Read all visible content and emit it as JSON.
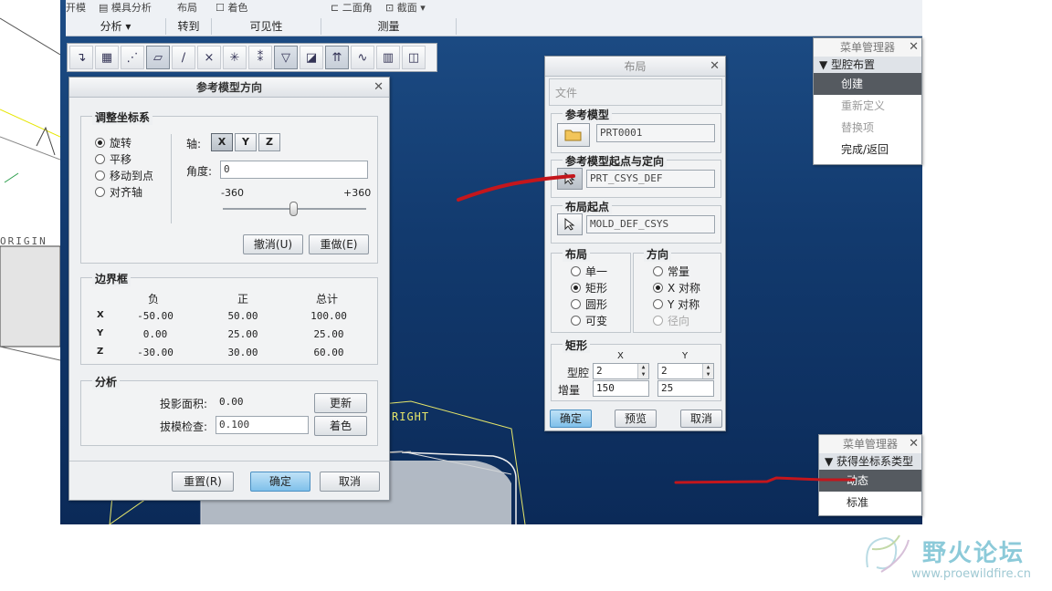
{
  "ribbon": {
    "top_items": [
      "开模",
      "模具分析",
      "布局",
      "着色",
      "二面角",
      "截面"
    ],
    "groups": [
      "分析",
      "转到",
      "可见性",
      "测量"
    ]
  },
  "viewport_labels": {
    "origin": "ORIGIN",
    "right": "RIGHT"
  },
  "orient_dialog": {
    "title": "参考模型方向",
    "adjust": {
      "title": "调整坐标系",
      "options": [
        "旋转",
        "平移",
        "移动到点",
        "对齐轴"
      ],
      "selected": "旋转",
      "axis_label": "轴:",
      "axes": [
        "X",
        "Y",
        "Z"
      ],
      "active_axis": "X",
      "angle_label": "角度:",
      "angle_value": "0",
      "slider_min": "-360",
      "slider_max": "+360",
      "slider_value": 0,
      "undo": "撤消(U)",
      "redo": "重做(E)"
    },
    "bbox": {
      "title": "边界框",
      "headers": [
        "负",
        "正",
        "总计"
      ],
      "rows": [
        {
          "axis": "X",
          "neg": "-50.00",
          "pos": "50.00",
          "total": "100.00"
        },
        {
          "axis": "Y",
          "neg": "0.00",
          "pos": "25.00",
          "total": "25.00"
        },
        {
          "axis": "Z",
          "neg": "-30.00",
          "pos": "30.00",
          "total": "60.00"
        }
      ]
    },
    "analysis": {
      "title": "分析",
      "proj_label": "投影面积:",
      "proj_value": "0.00",
      "update": "更新",
      "draft_label": "拔模检查:",
      "draft_value": "0.100",
      "shade": "着色"
    },
    "reset": "重置(R)",
    "ok": "确定",
    "cancel": "取消"
  },
  "layout_dialog": {
    "title": "布局",
    "file_menu": "文件",
    "ref_model": {
      "title": "参考模型",
      "value": "PRT0001"
    },
    "ref_origin": {
      "title": "参考模型起点与定向",
      "value": "PRT_CSYS_DEF"
    },
    "layout_origin": {
      "title": "布局起点",
      "value": "MOLD_DEF_CSYS"
    },
    "layout": {
      "title": "布局",
      "options": [
        "单一",
        "矩形",
        "圆形",
        "可变"
      ],
      "selected": "矩形"
    },
    "direction": {
      "title": "方向",
      "options": [
        "常量",
        "X 对称",
        "Y 对称",
        "径向"
      ],
      "selected": "X 对称",
      "disabled": "径向"
    },
    "rect": {
      "title": "矩形",
      "col_x": "X",
      "col_y": "Y",
      "cavity_label": "型腔",
      "cavity_x": "2",
      "cavity_y": "2",
      "incr_label": "增量",
      "incr_x": "150",
      "incr_y": "25"
    },
    "ok": "确定",
    "preview": "预览",
    "cancel": "取消"
  },
  "menu1": {
    "title": "菜单管理器",
    "section": "型腔布置",
    "items": [
      "创建",
      "重新定义",
      "替换项",
      "完成/返回"
    ],
    "selected": "创建"
  },
  "menu2": {
    "title": "菜单管理器",
    "section": "获得坐标系类型",
    "items": [
      "动态",
      "标准"
    ],
    "selected": "动态"
  },
  "watermark": {
    "text": "野火论坛",
    "url": "www.proewildfire.cn"
  },
  "colors": {
    "annotation_arrow": "#c4161c",
    "viewport_blue": "#123a6e",
    "highlight": "#7fc0ea"
  }
}
